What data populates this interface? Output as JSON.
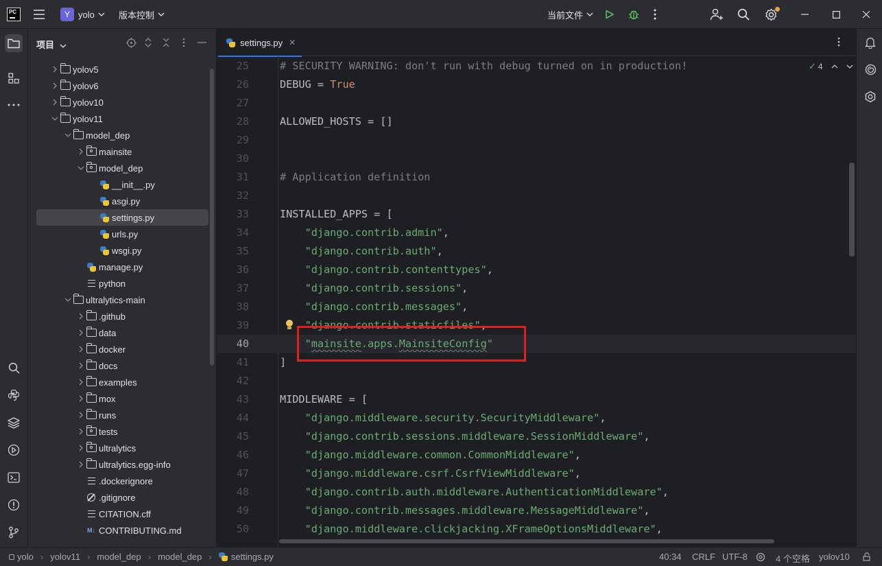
{
  "titlebar": {
    "logo_text": "PC",
    "project_badge": "Y",
    "project_name": "yolo",
    "vcs_menu": "版本控制",
    "run_config": "当前文件",
    "icons": [
      "hamburger-icon",
      "run-icon",
      "debug-icon",
      "more-icon",
      "add-user-icon",
      "search-icon",
      "settings-icon",
      "minimize-icon",
      "maximize-icon",
      "close-icon"
    ]
  },
  "project_panel": {
    "title": "项目",
    "tree": [
      {
        "label": "yolov5",
        "type": "folder",
        "level": 0,
        "expanded": false
      },
      {
        "label": "yolov6",
        "type": "folder",
        "level": 0,
        "expanded": false
      },
      {
        "label": "yolov10",
        "type": "folder",
        "level": 0,
        "expanded": false
      },
      {
        "label": "yolov11",
        "type": "folder",
        "level": 0,
        "expanded": true
      },
      {
        "label": "model_dep",
        "type": "folder",
        "level": 1,
        "expanded": true
      },
      {
        "label": "mainsite",
        "type": "package",
        "level": 2,
        "expanded": false
      },
      {
        "label": "model_dep",
        "type": "package",
        "level": 2,
        "expanded": true
      },
      {
        "label": "__init__.py",
        "type": "py",
        "level": 3
      },
      {
        "label": "asgi.py",
        "type": "py",
        "level": 3
      },
      {
        "label": "settings.py",
        "type": "py",
        "level": 3,
        "selected": true
      },
      {
        "label": "urls.py",
        "type": "py",
        "level": 3
      },
      {
        "label": "wsgi.py",
        "type": "py",
        "level": 3
      },
      {
        "label": "manage.py",
        "type": "py",
        "level": 2
      },
      {
        "label": "python",
        "type": "text",
        "level": 2
      },
      {
        "label": "ultralytics-main",
        "type": "folder",
        "level": 1,
        "expanded": true
      },
      {
        "label": ".github",
        "type": "folder",
        "level": 2,
        "expanded": false
      },
      {
        "label": "data",
        "type": "folder",
        "level": 2,
        "expanded": false
      },
      {
        "label": "docker",
        "type": "folder",
        "level": 2,
        "expanded": false
      },
      {
        "label": "docs",
        "type": "folder",
        "level": 2,
        "expanded": false
      },
      {
        "label": "examples",
        "type": "folder",
        "level": 2,
        "expanded": false
      },
      {
        "label": "mox",
        "type": "folder",
        "level": 2,
        "expanded": false
      },
      {
        "label": "runs",
        "type": "folder",
        "level": 2,
        "expanded": false
      },
      {
        "label": "tests",
        "type": "package",
        "level": 2,
        "expanded": false
      },
      {
        "label": "ultralytics",
        "type": "package",
        "level": 2,
        "expanded": false
      },
      {
        "label": "ultralytics.egg-info",
        "type": "folder",
        "level": 2,
        "expanded": false
      },
      {
        "label": ".dockerignore",
        "type": "text",
        "level": 2
      },
      {
        "label": ".gitignore",
        "type": "ignore",
        "level": 2
      },
      {
        "label": "CITATION.cff",
        "type": "text",
        "level": 2
      },
      {
        "label": "CONTRIBUTING.md",
        "type": "md",
        "level": 2
      }
    ]
  },
  "editor": {
    "tab_label": "settings.py",
    "inspection_count": "4",
    "current_line": "40",
    "lines": [
      {
        "n": "25",
        "parts": [
          [
            "com",
            "# SECURITY WARNING: don't run with debug turned on in production!"
          ]
        ]
      },
      {
        "n": "26",
        "parts": [
          [
            "txt",
            "DEBUG = "
          ],
          [
            "kw",
            "True"
          ]
        ]
      },
      {
        "n": "27",
        "parts": []
      },
      {
        "n": "28",
        "parts": [
          [
            "txt",
            "ALLOWED_HOSTS = []"
          ]
        ]
      },
      {
        "n": "29",
        "parts": []
      },
      {
        "n": "30",
        "parts": []
      },
      {
        "n": "31",
        "parts": [
          [
            "com",
            "# Application definition"
          ]
        ]
      },
      {
        "n": "32",
        "parts": []
      },
      {
        "n": "33",
        "parts": [
          [
            "txt",
            "INSTALLED_APPS = ["
          ]
        ]
      },
      {
        "n": "34",
        "parts": [
          [
            "txt",
            "    "
          ],
          [
            "str",
            "\"django.contrib.admin\""
          ],
          [
            "txt",
            ","
          ]
        ]
      },
      {
        "n": "35",
        "parts": [
          [
            "txt",
            "    "
          ],
          [
            "str",
            "\"django.contrib.auth\""
          ],
          [
            "txt",
            ","
          ]
        ]
      },
      {
        "n": "36",
        "parts": [
          [
            "txt",
            "    "
          ],
          [
            "str",
            "\"django.contrib.contenttypes\""
          ],
          [
            "txt",
            ","
          ]
        ]
      },
      {
        "n": "37",
        "parts": [
          [
            "txt",
            "    "
          ],
          [
            "str",
            "\"django.contrib.sessions\""
          ],
          [
            "txt",
            ","
          ]
        ]
      },
      {
        "n": "38",
        "parts": [
          [
            "txt",
            "    "
          ],
          [
            "str",
            "\"django.contrib.messages\""
          ],
          [
            "txt",
            ","
          ]
        ]
      },
      {
        "n": "39",
        "parts": [
          [
            "txt",
            "    "
          ],
          [
            "str",
            "\"django.contrib.staticfiles\""
          ],
          [
            "txt",
            ","
          ]
        ]
      },
      {
        "n": "40",
        "parts": [
          [
            "txt",
            "    "
          ],
          [
            "str",
            "\""
          ],
          [
            "strw",
            "mainsite"
          ],
          [
            "str",
            ".apps."
          ],
          [
            "strw",
            "MainsiteConfig"
          ],
          [
            "str",
            "\""
          ]
        ]
      },
      {
        "n": "41",
        "parts": [
          [
            "txt",
            "]"
          ]
        ]
      },
      {
        "n": "42",
        "parts": []
      },
      {
        "n": "43",
        "parts": [
          [
            "txt",
            "MIDDLEWARE = ["
          ]
        ]
      },
      {
        "n": "44",
        "parts": [
          [
            "txt",
            "    "
          ],
          [
            "str",
            "\"django.middleware.security.SecurityMiddleware\""
          ],
          [
            "txt",
            ","
          ]
        ]
      },
      {
        "n": "45",
        "parts": [
          [
            "txt",
            "    "
          ],
          [
            "str",
            "\"django.contrib.sessions.middleware.SessionMiddleware\""
          ],
          [
            "txt",
            ","
          ]
        ]
      },
      {
        "n": "46",
        "parts": [
          [
            "txt",
            "    "
          ],
          [
            "str",
            "\"django.middleware.common.CommonMiddleware\""
          ],
          [
            "txt",
            ","
          ]
        ]
      },
      {
        "n": "47",
        "parts": [
          [
            "txt",
            "    "
          ],
          [
            "str",
            "\"django.middleware.csrf.CsrfViewMiddleware\""
          ],
          [
            "txt",
            ","
          ]
        ]
      },
      {
        "n": "48",
        "parts": [
          [
            "txt",
            "    "
          ],
          [
            "str",
            "\"django.contrib.auth.middleware.AuthenticationMiddleware\""
          ],
          [
            "txt",
            ","
          ]
        ]
      },
      {
        "n": "49",
        "parts": [
          [
            "txt",
            "    "
          ],
          [
            "str",
            "\"django.contrib.messages.middleware.MessageMiddleware\""
          ],
          [
            "txt",
            ","
          ]
        ]
      },
      {
        "n": "50",
        "parts": [
          [
            "txt",
            "    "
          ],
          [
            "str",
            "\"django.middleware.clickjacking.XFrameOptionsMiddleware\""
          ],
          [
            "txt",
            ","
          ]
        ]
      }
    ]
  },
  "statusbar": {
    "breadcrumb": [
      "yolo",
      "yolov11",
      "model_dep",
      "model_dep",
      "settings.py"
    ],
    "position": "40:34",
    "line_ending": "CRLF",
    "encoding": "UTF-8",
    "indent": "4 个空格",
    "interpreter": "yolov10"
  },
  "colors": {
    "accent": "#3574f0",
    "highlight_box": "#e02020",
    "string": "#6aab73",
    "keyword": "#cf8e6d",
    "comment": "#7a7e85"
  }
}
